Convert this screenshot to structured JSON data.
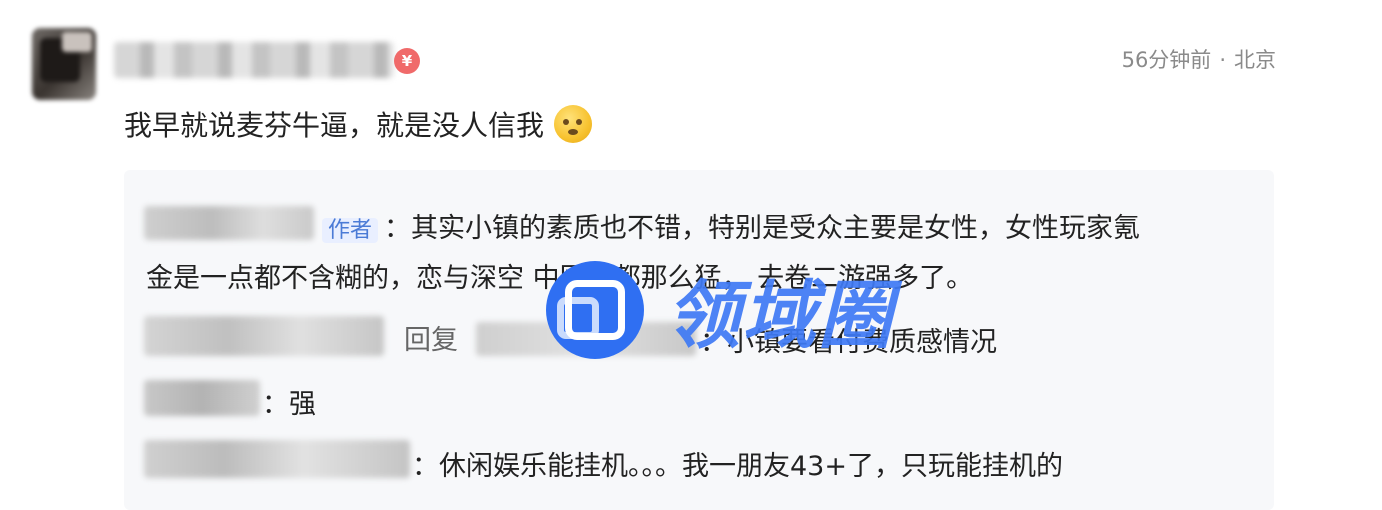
{
  "comment": {
    "time": "56分钟前",
    "separator": "·",
    "location": "北京",
    "badge": "¥",
    "text": "我早就说麦芬牛逼，就是没人信我",
    "emoji": "dizzy-face-emoji"
  },
  "replies": [
    {
      "tag": "作者",
      "line1": "：其实小镇的素质也不错，特别是受众主要是女性，女性玩家氪",
      "line2": "金是一点都不含糊的，恋与深空   中国外都那么猛，           去卷二游强多了。"
    },
    {
      "reply_word": "回复",
      "text": "：小镇要看付费质感情况"
    },
    {
      "text": "：强"
    },
    {
      "text": "：休闲娱乐能挂机。。。我一朋友43+了，只玩能挂机的"
    }
  ],
  "watermark": {
    "text": "领域圈",
    "icon": "watermark-logo-icon"
  },
  "colors": {
    "accent": "#3f7af5",
    "meta": "#8a8a8a",
    "reply_bg": "#f7f8fa",
    "author_tag": "#4b7bd6"
  }
}
